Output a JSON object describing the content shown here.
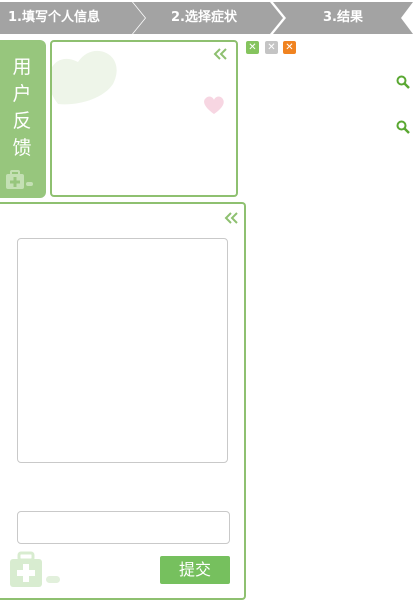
{
  "steps": [
    {
      "label": "1.填写个人信息"
    },
    {
      "label": "2.选择症状"
    },
    {
      "label": "3.结果"
    }
  ],
  "side_tab": {
    "chars": [
      "用",
      "户",
      "反",
      "馈"
    ]
  },
  "window_controls": [
    {
      "icon": "close-icon",
      "color": "#85c45e"
    },
    {
      "icon": "close-icon",
      "color": "#c4c4c4"
    },
    {
      "icon": "close-icon",
      "color": "#f08320"
    }
  ],
  "feedback": {
    "textarea_value": "",
    "contact_value": "",
    "submit_label": "提交"
  },
  "colors": {
    "accent_green": "#8ec070",
    "tab_green": "#97c67d",
    "button_green": "#76c05e",
    "step_gray": "#a3a3a3",
    "search_green": "#5aa832"
  }
}
